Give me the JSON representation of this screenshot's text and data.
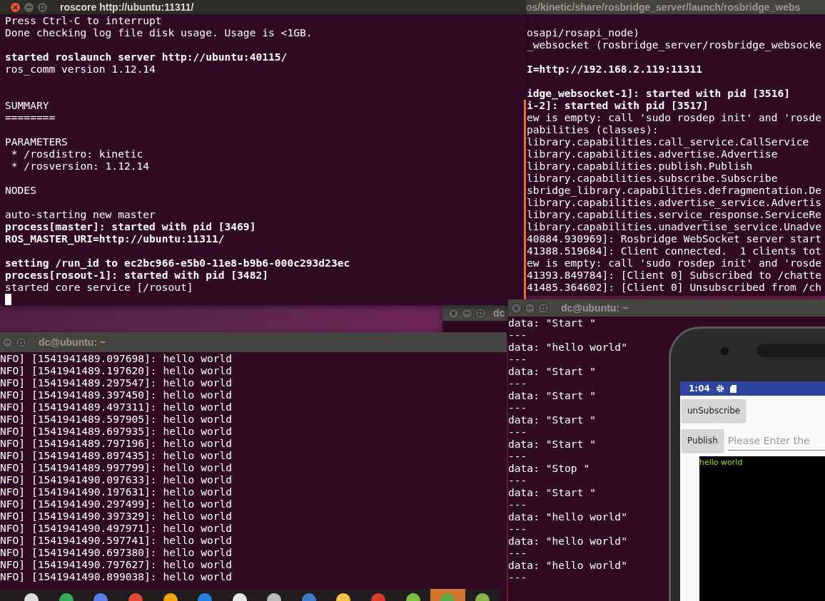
{
  "windows": [
    {
      "title": "roscore http://ubuntu:11311/",
      "active": true,
      "cursor": true,
      "lines": [
        {
          "kind": "text",
          "text": "Press Ctrl-C to interrupt",
          "bold": false
        },
        {
          "kind": "text",
          "text": "Done checking log file disk usage. Usage is <1GB.",
          "bold": false
        },
        {
          "kind": "blank"
        },
        {
          "kind": "text",
          "text": "started roslaunch server http://ubuntu:40115/",
          "bold": true
        },
        {
          "kind": "text",
          "text": "ros_comm version 1.12.14",
          "bold": false
        },
        {
          "kind": "blank"
        },
        {
          "kind": "blank"
        },
        {
          "kind": "text",
          "text": "SUMMARY",
          "bold": false
        },
        {
          "kind": "text",
          "text": "========",
          "bold": false
        },
        {
          "kind": "blank"
        },
        {
          "kind": "text",
          "text": "PARAMETERS",
          "bold": false
        },
        {
          "kind": "text",
          "text": " * /rosdistro: kinetic",
          "bold": false
        },
        {
          "kind": "text",
          "text": " * /rosversion: 1.12.14",
          "bold": false
        },
        {
          "kind": "blank"
        },
        {
          "kind": "text",
          "text": "NODES",
          "bold": false
        },
        {
          "kind": "blank"
        },
        {
          "kind": "text",
          "text": "auto-starting new master",
          "bold": false
        },
        {
          "kind": "text",
          "text": "process[master]: started with pid [3469]",
          "bold": true
        },
        {
          "kind": "text",
          "text": "ROS_MASTER_URI=http://ubuntu:11311/",
          "bold": true
        },
        {
          "kind": "blank"
        },
        {
          "kind": "text",
          "text": "setting /run_id to ec2bc966-e5b0-11e8-b9b6-000c293d23ec",
          "bold": true
        },
        {
          "kind": "text",
          "text": "process[rosout-1]: started with pid [3482]",
          "bold": true
        },
        {
          "kind": "text",
          "text": "started core service [/rosout]",
          "bold": false
        }
      ]
    },
    {
      "title": "os/kinetic/share/rosbridge_server/launch/rosbridge_webs",
      "active": false,
      "lines": [
        {
          "kind": "blank"
        },
        {
          "kind": "text",
          "text": "osapi/rosapi_node)",
          "bold": false
        },
        {
          "kind": "text",
          "text": "_websocket (rosbridge_server/rosbridge_websocke",
          "bold": false
        },
        {
          "kind": "blank"
        },
        {
          "kind": "text",
          "text": "I=http://192.168.2.119:11311",
          "bold": true
        },
        {
          "kind": "blank"
        },
        {
          "kind": "text",
          "text": "idge_websocket-1]: started with pid [3516]",
          "bold": true
        },
        {
          "kind": "text",
          "text": "i-2]: started with pid [3517]",
          "bold": true
        },
        {
          "kind": "text",
          "text": "ew is empty: call 'sudo rosdep init' and 'rosde",
          "bold": false
        },
        {
          "kind": "text",
          "text": "pabilities (classes):",
          "bold": false
        },
        {
          "kind": "text",
          "text": "library.capabilities.call_service.CallService",
          "bold": false
        },
        {
          "kind": "text",
          "text": "library.capabilities.advertise.Advertise",
          "bold": false
        },
        {
          "kind": "text",
          "text": "library.capabilities.publish.Publish",
          "bold": false
        },
        {
          "kind": "text",
          "text": "library.capabilities.subscribe.Subscribe",
          "bold": false
        },
        {
          "kind": "text",
          "text": "sbridge_library.capabilities.defragmentation.De",
          "bold": false
        },
        {
          "kind": "text",
          "text": "library.capabilities.advertise_service.Advertis",
          "bold": false
        },
        {
          "kind": "text",
          "text": "library.capabilities.service_response.ServiceRe",
          "bold": false
        },
        {
          "kind": "text",
          "text": "library.capabilities.unadvertise_service.Unadve",
          "bold": false
        },
        {
          "kind": "text",
          "text": "40884.930969]: Rosbridge WebSocket server start",
          "bold": false
        },
        {
          "kind": "text",
          "text": "41388.519684]: Client connected.  1 clients tot",
          "bold": false
        },
        {
          "kind": "text",
          "text": "ew is empty: call 'sudo rosdep init' and 'rosde",
          "bold": false
        },
        {
          "kind": "text",
          "text": "41393.849784]: [Client 0] Subscribed to /chatte",
          "bold": false
        },
        {
          "kind": "text",
          "text": "41485.364602]: [Client 0] Unsubscribed from /ch",
          "bold": false
        }
      ]
    },
    {
      "title": "dc@ubuntu: ~",
      "active": false,
      "lines": [
        {
          "kind": "text",
          "text": "NFO] [1541941489.097698]: hello world",
          "bold": false
        },
        {
          "kind": "text",
          "text": "NFO] [1541941489.197620]: hello world",
          "bold": false
        },
        {
          "kind": "text",
          "text": "NFO] [1541941489.297547]: hello world",
          "bold": false
        },
        {
          "kind": "text",
          "text": "NFO] [1541941489.397450]: hello world",
          "bold": false
        },
        {
          "kind": "text",
          "text": "NFO] [1541941489.497311]: hello world",
          "bold": false
        },
        {
          "kind": "text",
          "text": "NFO] [1541941489.597905]: hello world",
          "bold": false
        },
        {
          "kind": "text",
          "text": "NFO] [1541941489.697935]: hello world",
          "bold": false
        },
        {
          "kind": "text",
          "text": "NFO] [1541941489.797196]: hello world",
          "bold": false
        },
        {
          "kind": "text",
          "text": "NFO] [1541941489.897435]: hello world",
          "bold": false
        },
        {
          "kind": "text",
          "text": "NFO] [1541941489.997799]: hello world",
          "bold": false
        },
        {
          "kind": "text",
          "text": "NFO] [1541941490.097633]: hello world",
          "bold": false
        },
        {
          "kind": "text",
          "text": "NFO] [1541941490.197631]: hello world",
          "bold": false
        },
        {
          "kind": "text",
          "text": "NFO] [1541941490.297499]: hello world",
          "bold": false
        },
        {
          "kind": "text",
          "text": "NFO] [1541941490.397329]: hello world",
          "bold": false
        },
        {
          "kind": "text",
          "text": "NFO] [1541941490.497971]: hello world",
          "bold": false
        },
        {
          "kind": "text",
          "text": "NFO] [1541941490.597741]: hello world",
          "bold": false
        },
        {
          "kind": "text",
          "text": "NFO] [1541941490.697380]: hello world",
          "bold": false
        },
        {
          "kind": "text",
          "text": "NFO] [1541941490.797627]: hello world",
          "bold": false
        },
        {
          "kind": "text",
          "text": "NFO] [1541941490.899038]: hello world",
          "bold": false
        }
      ]
    },
    {
      "title": "dc",
      "active": false
    },
    {
      "title": "dc@ubuntu: ~",
      "active": false,
      "lines": [
        {
          "kind": "text",
          "text": "data: \"Start \"",
          "bold": false
        },
        {
          "kind": "text",
          "text": "---",
          "bold": false
        },
        {
          "kind": "text",
          "text": "data: \"hello world\"",
          "bold": false
        },
        {
          "kind": "text",
          "text": "---",
          "bold": false
        },
        {
          "kind": "text",
          "text": "data: \"Start \"",
          "bold": false
        },
        {
          "kind": "text",
          "text": "---",
          "bold": false
        },
        {
          "kind": "text",
          "text": "data: \"Start \"",
          "bold": false
        },
        {
          "kind": "text",
          "text": "---",
          "bold": false
        },
        {
          "kind": "text",
          "text": "data: \"Start \"",
          "bold": false
        },
        {
          "kind": "text",
          "text": "---",
          "bold": false
        },
        {
          "kind": "text",
          "text": "data: \"Start \"",
          "bold": false
        },
        {
          "kind": "text",
          "text": "---",
          "bold": false
        },
        {
          "kind": "text",
          "text": "data: \"Stop \"",
          "bold": false
        },
        {
          "kind": "text",
          "text": "---",
          "bold": false
        },
        {
          "kind": "text",
          "text": "data: \"Start \"",
          "bold": false
        },
        {
          "kind": "text",
          "text": "---",
          "bold": false
        },
        {
          "kind": "text",
          "text": "data: \"hello world\"",
          "bold": false
        },
        {
          "kind": "text",
          "text": "---",
          "bold": false
        },
        {
          "kind": "text",
          "text": "data: \"hello world\"",
          "bold": false
        },
        {
          "kind": "text",
          "text": "---",
          "bold": false
        },
        {
          "kind": "text",
          "text": "data: \"hello world\"",
          "bold": false
        },
        {
          "kind": "text",
          "text": "---",
          "bold": false
        }
      ]
    }
  ],
  "phone": {
    "time": "1:04",
    "buttons": [
      "unSubscribe",
      "Publish"
    ],
    "input": {
      "placeholder": "Please Enter the"
    },
    "output": "hello world"
  },
  "taskbar": {
    "items": [
      {
        "color": "#dddddd",
        "selected": false
      },
      {
        "color": "#3aa757",
        "selected": false
      },
      {
        "color": "#5a7de6",
        "selected": false
      },
      {
        "color": "#dd4b39",
        "selected": false
      },
      {
        "color": "#f0a30a",
        "selected": false
      },
      {
        "color": "#2a7de1",
        "selected": false
      },
      {
        "color": "#e8e8e8",
        "selected": false
      },
      {
        "color": "#bbbbbb",
        "selected": false
      },
      {
        "color": "#3e7cc7",
        "selected": false
      },
      {
        "color": "#f5c242",
        "selected": false
      },
      {
        "color": "#d63b2f",
        "selected": false
      },
      {
        "color": "#7ac143",
        "selected": false
      },
      {
        "color": "#5fa84a",
        "selected": true
      },
      {
        "color": "#88b04b",
        "selected": false
      }
    ]
  }
}
